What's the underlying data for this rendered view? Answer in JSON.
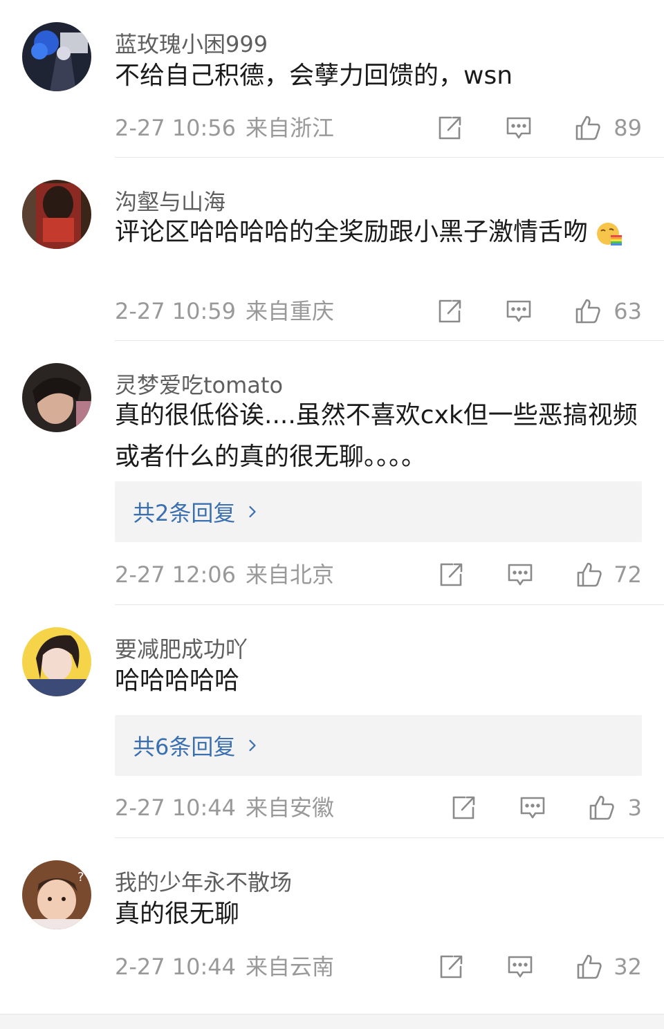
{
  "comments": [
    {
      "username": "蓝玫瑰小困999",
      "text": "不给自己积德，会孽力回馈的，wsn",
      "time": "2-27 10:56",
      "location": "来自浙江",
      "likes": "89"
    },
    {
      "username": "沟壑与山海",
      "text": "评论区哈哈哈哈的全奖励跟小黑子激情舌吻",
      "emoji": "rainbow-vomit-emoji",
      "time": "2-27 10:59",
      "location": "来自重庆",
      "likes": "63"
    },
    {
      "username": "灵梦爱吃tomato",
      "text": "真的很低俗诶....虽然不喜欢cxk但一些恶搞视频或者什么的真的很无聊。。。。",
      "replies": "共2条回复",
      "time": "2-27 12:06",
      "location": "来自北京",
      "likes": "72"
    },
    {
      "username": "要减肥成功吖",
      "text": "哈哈哈哈哈",
      "replies": "共6条回复",
      "time": "2-27 10:44",
      "location": "来自安徽",
      "likes": "3"
    },
    {
      "username": "我的少年永不散场",
      "text": "真的很无聊",
      "time": "2-27 10:44",
      "location": "来自云南",
      "likes": "32"
    }
  ],
  "icons": {
    "share": "share-icon",
    "reply": "comment-icon",
    "like": "thumbs-up-icon",
    "chevron": "chevron-right-icon"
  },
  "colors": {
    "username": "#5f5f5f",
    "meta": "#999999",
    "link": "#3a6fb0",
    "reply_bg": "#f3f3f3",
    "icon": "#8a8a8a"
  }
}
